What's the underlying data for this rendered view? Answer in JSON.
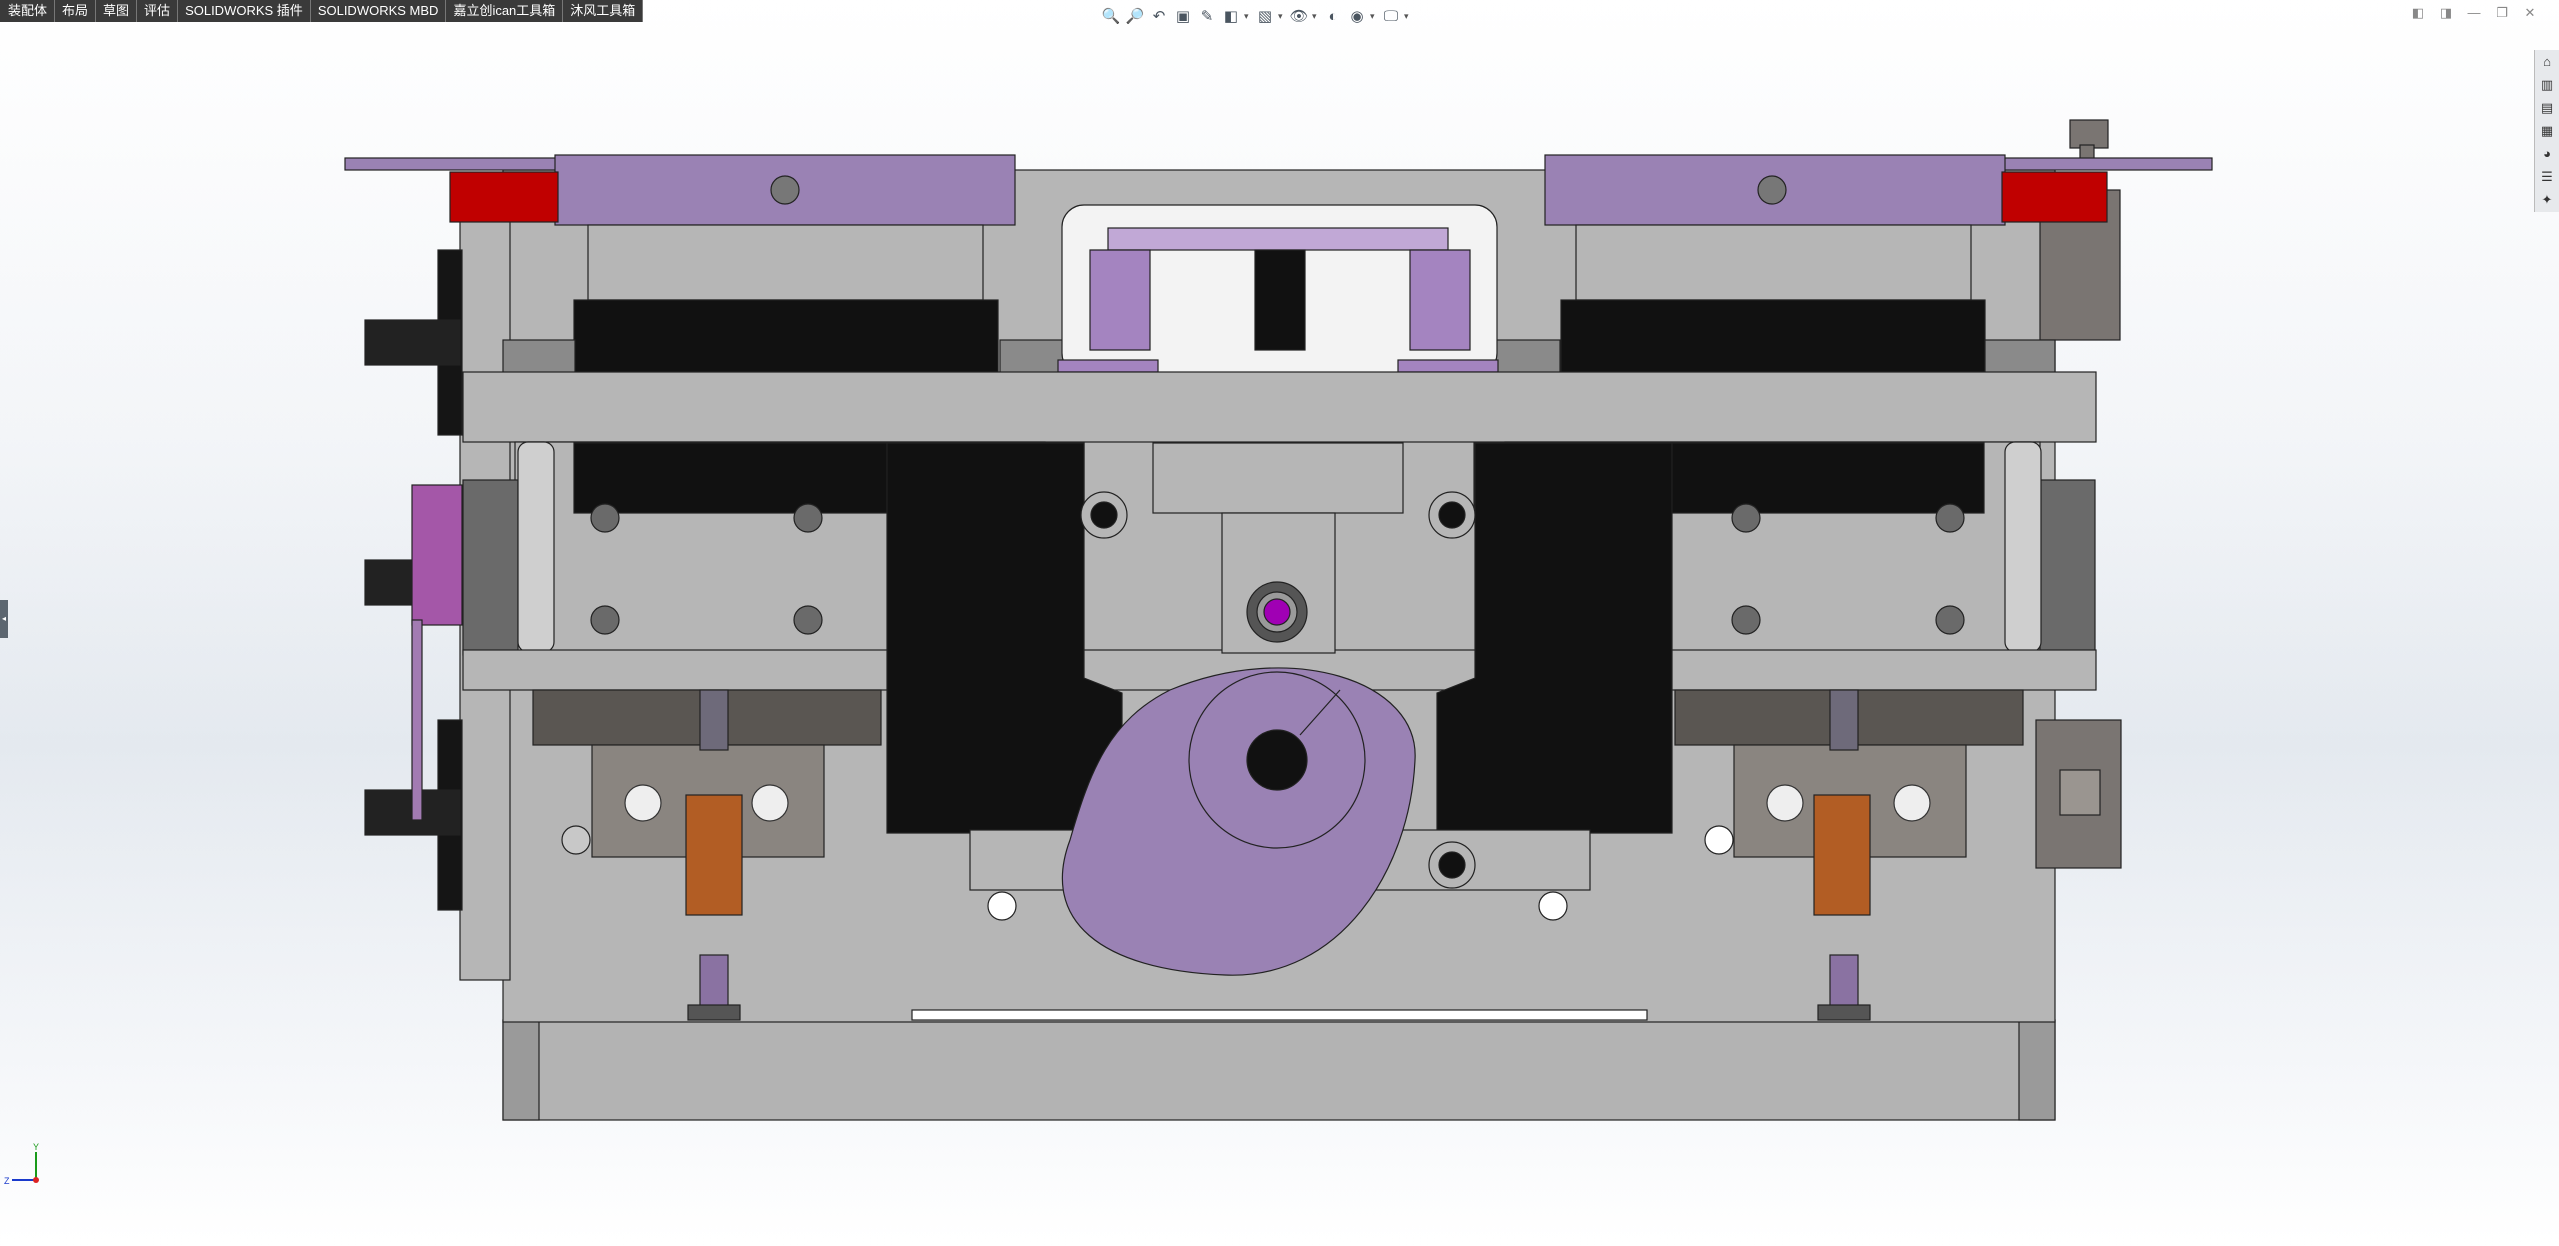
{
  "menu_tabs": [
    "装配体",
    "布局",
    "草图",
    "评估",
    "SOLIDWORKS 插件",
    "SOLIDWORKS MBD",
    "嘉立创ican工具箱",
    "沐风工具箱"
  ],
  "heads_up_toolbar": {
    "icons": [
      "zoom-to-fit-icon",
      "zoom-to-area-icon",
      "previous-view-icon",
      "section-view-icon",
      "dynamic-annotation-icon",
      "view-orientation-icon",
      "display-style-icon",
      "hide-show-icon",
      "edit-appearance-icon",
      "apply-scene-icon",
      "view-settings-icon"
    ],
    "glyphs": [
      "🔍",
      "🔎",
      "↶",
      "▣",
      "✎",
      "◧",
      "▧",
      "👁",
      "◐",
      "◉",
      "🖵"
    ]
  },
  "window_controls": [
    "◧",
    "◨",
    "—",
    "❐",
    "✕"
  ],
  "task_pane": {
    "icons": [
      "home-icon",
      "design-library-icon",
      "file-explorer-icon",
      "view-palette-icon",
      "appearances-icon",
      "custom-properties-icon",
      "forum-icon"
    ],
    "glyphs": [
      "⌂",
      "▥",
      "▤",
      "▦",
      "◕",
      "☰",
      "✦"
    ]
  },
  "triad": {
    "y_label": "Y",
    "z_label": "Z"
  },
  "colors": {
    "accent_purple": "#9a82b4",
    "red_block": "#c00000",
    "frame_gray": "#b4b4b4",
    "black_part": "#111111",
    "orange_tube": "#b25d24"
  }
}
